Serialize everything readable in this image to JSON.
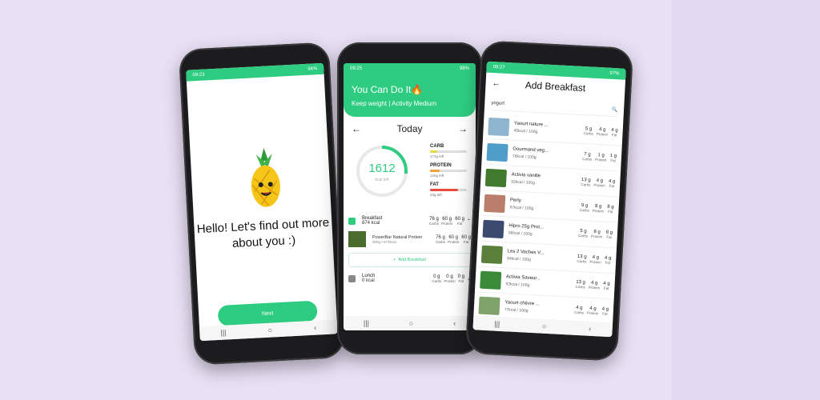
{
  "phone1": {
    "status_time": "09:23",
    "status_battery": "94%",
    "heading": "Hello! Let's find out more about you :)",
    "next_label": "Next"
  },
  "phone2": {
    "status_time": "09:25",
    "status_battery": "98%",
    "title": "You Can Do It🔥",
    "subtitle": "Keep weight | Activity Medium",
    "day": "Today",
    "kcal_value": "1612",
    "kcal_label": "kcal left",
    "macros": [
      {
        "name": "CARB",
        "left": "173g left",
        "color": "#e6d93a",
        "fraction": 0.2
      },
      {
        "name": "PROTEIN",
        "left": "126g left",
        "color": "#f1a03a",
        "fraction": 0.25
      },
      {
        "name": "FAT",
        "left": "23g left",
        "color": "#e84c3d",
        "fraction": 0.75
      }
    ],
    "breakfast": {
      "name": "Breakfast",
      "kcal": "874 kcal",
      "carbs": "76",
      "protein": "60",
      "fat": "60"
    },
    "food": {
      "name": "PowerBar Natural Protein",
      "detail": "300g • 874kcal",
      "carbs": "76",
      "protein": "60",
      "fat": "60"
    },
    "add_label": "Add Breakfast",
    "lunch": {
      "name": "Lunch",
      "kcal": "0 kcal",
      "carbs": "0",
      "protein": "0",
      "fat": "0"
    },
    "unit_g": "g",
    "labels": {
      "carbs": "Carbs",
      "protein": "Protein",
      "fat": "Fat"
    }
  },
  "phone3": {
    "status_time": "09:27",
    "status_battery": "97%",
    "title": "Add Breakfast",
    "query": "yogurt",
    "items": [
      {
        "name": "Yaourt nature ...",
        "kcal": "45kcal / 100g",
        "carbs": "5",
        "protein": "4",
        "fat": "4",
        "color": "#8fb5cf"
      },
      {
        "name": "Gourmand veg...",
        "kcal": "76kcal / 100g",
        "carbs": "7",
        "protein": "1",
        "fat": "1",
        "color": "#4f9dc9"
      },
      {
        "name": "Activia vanille",
        "kcal": "92kcal / 100g",
        "carbs": "13",
        "protein": "4",
        "fat": "4",
        "color": "#3f7a2d"
      },
      {
        "name": "Perly",
        "kcal": "97kcal / 100g",
        "carbs": "9",
        "protein": "8",
        "fat": "8",
        "color": "#b97f6a"
      },
      {
        "name": "Hipro 25g Prot...",
        "kcal": "58kcal / 100g",
        "carbs": "5",
        "protein": "8",
        "fat": "8",
        "color": "#3b4a6e"
      },
      {
        "name": "Les 2 Vaches V...",
        "kcal": "94kcal / 100g",
        "carbs": "13",
        "protein": "4",
        "fat": "4",
        "color": "#5a7f3a"
      },
      {
        "name": "Activia Saveur...",
        "kcal": "92kcal / 100g",
        "carbs": "13",
        "protein": "4",
        "fat": "4",
        "color": "#3a8a3a"
      },
      {
        "name": "Yaourt chèvre ...",
        "kcal": "77kcal / 100g",
        "carbs": "4",
        "protein": "4",
        "fat": "4",
        "color": "#7fa36a"
      }
    ]
  }
}
